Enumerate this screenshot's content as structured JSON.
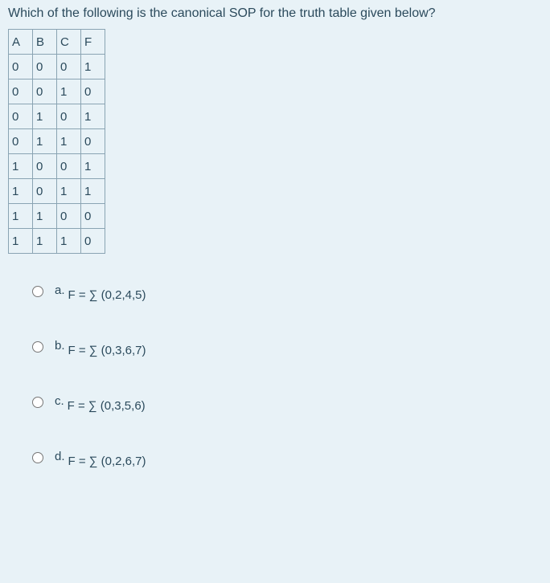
{
  "question": "Which of the following is the canonical SOP for the truth table given below?",
  "tableHeaders": [
    "A",
    "B",
    "C",
    "F"
  ],
  "tableRows": [
    [
      "0",
      "0",
      "0",
      "1"
    ],
    [
      "0",
      "0",
      "1",
      "0"
    ],
    [
      "0",
      "1",
      "0",
      "1"
    ],
    [
      "0",
      "1",
      "1",
      "0"
    ],
    [
      "1",
      "0",
      "0",
      "1"
    ],
    [
      "1",
      "0",
      "1",
      "1"
    ],
    [
      "1",
      "1",
      "0",
      "0"
    ],
    [
      "1",
      "1",
      "1",
      "0"
    ]
  ],
  "options": {
    "a": {
      "letter": "a.",
      "formula": "F = ∑ (0,2,4,5)"
    },
    "b": {
      "letter": "b.",
      "formula": "F = ∑ (0,3,6,7)"
    },
    "c": {
      "letter": "c.",
      "formula": "F = ∑ (0,3,5,6)"
    },
    "d": {
      "letter": "d.",
      "formula": "F = ∑ (0,2,6,7)"
    }
  }
}
